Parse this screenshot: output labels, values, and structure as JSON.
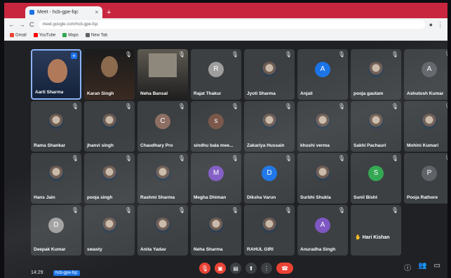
{
  "browser": {
    "tab_title": "Meet - hcb-gpe-fqc",
    "address": "meet.google.com/hcb-gpe-fqc",
    "bookmarks": [
      "Gmail",
      "YouTube",
      "Maps",
      "New Tab"
    ]
  },
  "participants": [
    {
      "name": "Aarti Sharma",
      "kind": "video1"
    },
    {
      "name": "Karan Singh",
      "kind": "video2"
    },
    {
      "name": "Neha Bansal",
      "kind": "video3"
    },
    {
      "name": "Rajat Thakur",
      "initial": "R",
      "color": "#9e9e9e"
    },
    {
      "name": "Jyoti Sharma",
      "kind": "photo"
    },
    {
      "name": "Anjali",
      "initial": "A",
      "color": "#1a73e8"
    },
    {
      "name": "pooja gautam",
      "kind": "photo"
    },
    {
      "name": "Ashutosh Kumar",
      "initial": "A",
      "color": "#5f6368"
    },
    {
      "name": "Rama Shankar",
      "kind": "photo"
    },
    {
      "name": "jhanvi singh",
      "kind": "photo"
    },
    {
      "name": "Chaudhary Pro",
      "initial": "C",
      "color": "#8d6e63"
    },
    {
      "name": "sindhu bala mee...",
      "initial": "s",
      "color": "#795548"
    },
    {
      "name": "Zakariya Hussain",
      "kind": "photo"
    },
    {
      "name": "khushi verma",
      "kind": "photo"
    },
    {
      "name": "Sakhi Pachauri",
      "kind": "photo"
    },
    {
      "name": "Mohini Kumari",
      "kind": "photo"
    },
    {
      "name": "Hans Jain",
      "kind": "photo"
    },
    {
      "name": "pooja singh",
      "kind": "photo"
    },
    {
      "name": "Rashmi Sharma",
      "kind": "photo"
    },
    {
      "name": "Megha Dhiman",
      "initial": "M",
      "color": "#7e57c2"
    },
    {
      "name": "Diksha Varun",
      "initial": "D",
      "color": "#1a73e8"
    },
    {
      "name": "Surbhi Shukla",
      "kind": "photo"
    },
    {
      "name": "Sunil Bisht",
      "initial": "S",
      "color": "#34a853"
    },
    {
      "name": "Pooja Rathore",
      "initial": "P",
      "color": "#5f6368"
    },
    {
      "name": "Deepak Kumar",
      "initial": "D",
      "color": "#9e9e9e"
    },
    {
      "name": "swasty",
      "kind": "photo"
    },
    {
      "name": "Anita Yadav",
      "kind": "photo"
    },
    {
      "name": "Neha Sharma",
      "kind": "photo"
    },
    {
      "name": "RAHUL GIRI",
      "kind": "photo"
    },
    {
      "name": "Anuradha Singh",
      "initial": "A",
      "color": "#7e57c2"
    },
    {
      "name": "Hari Kishan",
      "kind": "raised"
    }
  ],
  "bottom": {
    "time": "14:29",
    "meeting_code": "hcb-gpe-fqc"
  }
}
